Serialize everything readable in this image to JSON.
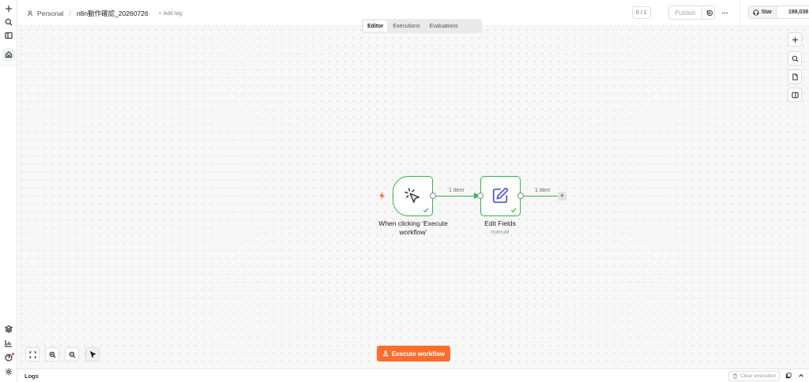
{
  "header": {
    "project": "Personal",
    "workflow_name": "n8n動作確認_20260726",
    "add_tag": "+ Add tag",
    "version_counter": "0 / 1",
    "publish_label": "Publish",
    "github_star_label": "Star",
    "github_star_count": "198,038"
  },
  "tabs": [
    {
      "label": "Editor",
      "active": true
    },
    {
      "label": "Executions",
      "active": false
    },
    {
      "label": "Evaluations",
      "active": false
    }
  ],
  "nodes": {
    "trigger": {
      "label": "When clicking ‘Execute workflow’",
      "icon": "cursor-click-icon",
      "status": "success"
    },
    "edit_fields": {
      "label": "Edit Fields",
      "sublabel": "manual",
      "icon": "pen-square-icon",
      "status": "success"
    }
  },
  "connections": {
    "c1_label": "1 item",
    "c2_label": "1 item"
  },
  "execute_button_label": "Execute workflow",
  "logs": {
    "title": "Logs",
    "clear_label": "Clear execution"
  },
  "colors": {
    "accent": "#ff6d2d",
    "success": "#35b34a",
    "edit_icon": "#5b5bd6"
  }
}
